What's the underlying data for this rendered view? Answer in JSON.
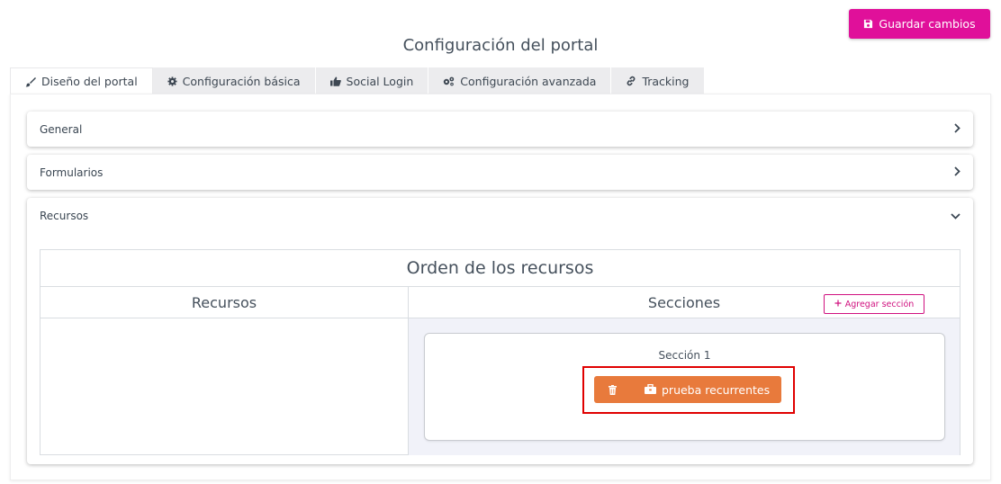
{
  "toolbar": {
    "save_label": "Guardar cambios"
  },
  "page": {
    "title": "Configuración del portal"
  },
  "tabs": [
    {
      "label": "Diseño del portal",
      "icon": "brush-icon",
      "active": true
    },
    {
      "label": "Configuración básica",
      "icon": "gear-icon",
      "active": false
    },
    {
      "label": "Social Login",
      "icon": "thumbs-up-icon",
      "active": false
    },
    {
      "label": "Configuración avanzada",
      "icon": "gears-icon",
      "active": false
    },
    {
      "label": "Tracking",
      "icon": "link-icon",
      "active": false
    }
  ],
  "accordions": {
    "general": {
      "label": "General",
      "expanded": false
    },
    "forms": {
      "label": "Formularios",
      "expanded": false
    },
    "resources": {
      "label": "Recursos",
      "expanded": true
    }
  },
  "order": {
    "title": "Orden de los recursos",
    "resources_header": "Recursos",
    "sections_header": "Secciones",
    "add_section_label": "Agregar sección",
    "sections": [
      {
        "title": "Sección 1",
        "items": [
          {
            "label": "prueba recurrentes"
          }
        ]
      }
    ]
  },
  "colors": {
    "accent": "#e0109a",
    "resource_chip": "#e87a3c",
    "highlight": "#e00000",
    "sections_bg": "#f1f2f9"
  }
}
